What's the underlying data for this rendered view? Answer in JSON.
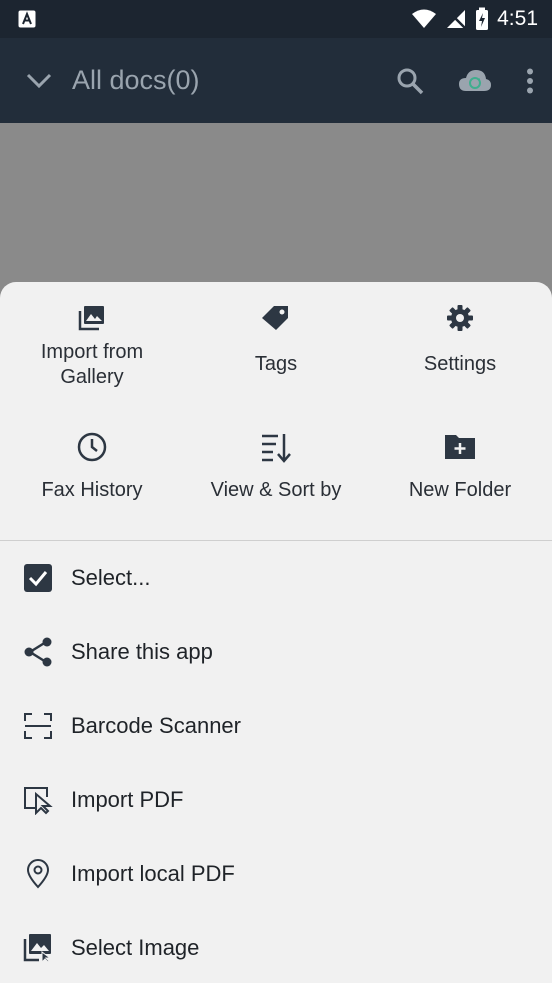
{
  "status_bar": {
    "time": "4:51"
  },
  "app_bar": {
    "title": "All docs(0)"
  },
  "grid": [
    {
      "label": "Import from\nGallery",
      "icon": "gallery-icon"
    },
    {
      "label": "Tags",
      "icon": "tag-icon"
    },
    {
      "label": "Settings",
      "icon": "gear-icon"
    },
    {
      "label": "Fax History",
      "icon": "clock-icon"
    },
    {
      "label": "View & Sort by",
      "icon": "sort-icon"
    },
    {
      "label": "New Folder",
      "icon": "new-folder-icon"
    }
  ],
  "list": [
    {
      "label": "Select...",
      "icon": "checkbox-icon"
    },
    {
      "label": "Share this app",
      "icon": "share-icon"
    },
    {
      "label": "Barcode Scanner",
      "icon": "barcode-scanner-icon"
    },
    {
      "label": "Import PDF",
      "icon": "import-pdf-icon"
    },
    {
      "label": "Import local PDF",
      "icon": "location-pin-icon"
    },
    {
      "label": "Select Image",
      "icon": "select-image-icon"
    }
  ],
  "colors": {
    "status_bar": "#1c2530",
    "app_bar": "#222d3a",
    "sheet": "#f1f1f1",
    "icon": "#2d3743",
    "accent_sync": "#3fae8e"
  }
}
